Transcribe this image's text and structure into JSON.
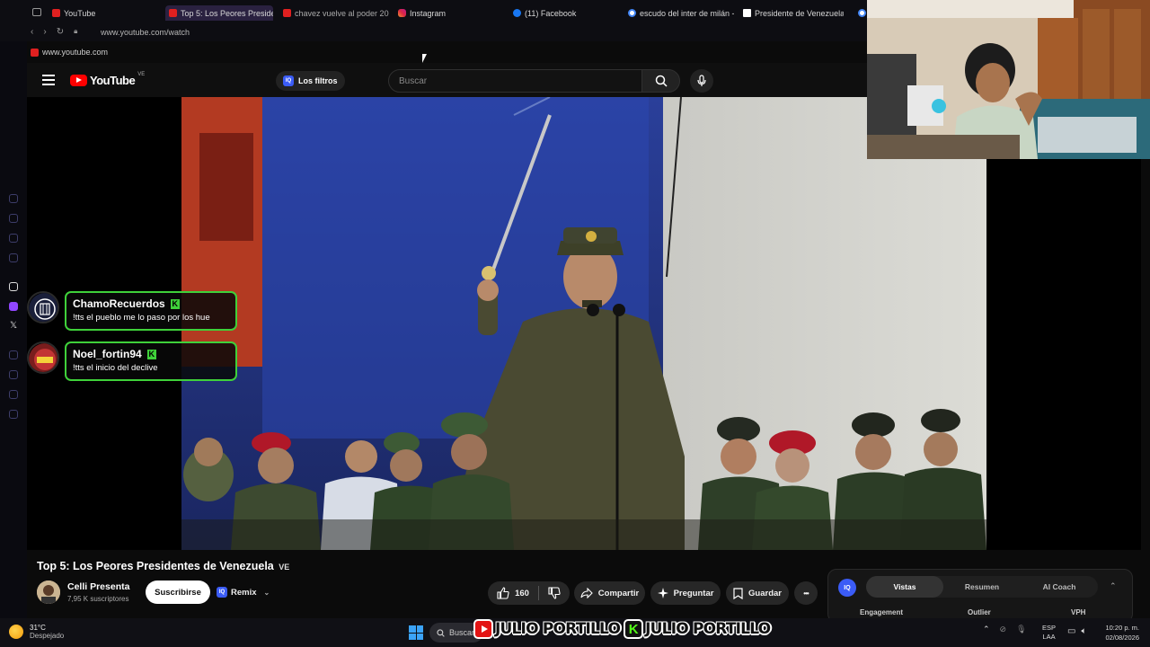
{
  "browser": {
    "tabs": [
      {
        "label": "YouTube",
        "icon": "youtube-favicon",
        "active": false
      },
      {
        "label": "Top 5: Los Peores Presiden",
        "icon": "youtube-favicon",
        "active": true
      },
      {
        "label": "chavez vuelve al poder 20",
        "icon": "youtube-favicon",
        "active": false
      },
      {
        "label": "Instagram",
        "icon": "instagram-favicon",
        "active": false
      },
      {
        "label": "(11) Facebook",
        "icon": "facebook-favicon",
        "active": false
      },
      {
        "label": "escudo del inter de milán -",
        "icon": "google-favicon",
        "active": false
      },
      {
        "label": "Presidente de Venezuela -",
        "icon": "wikipedia-favicon",
        "active": false
      }
    ],
    "url": "www.youtube.com/watch",
    "bookmark": "www.youtube.com"
  },
  "youtube": {
    "logo_text": "YouTube",
    "country_code": "VE",
    "filters_label": "Los filtros",
    "iq_badge": "IQ",
    "search_placeholder": "Buscar"
  },
  "chat": [
    {
      "user": "ChamoRecuerdos",
      "message": "!tts el pueblo me lo paso por los hue",
      "badge": "K"
    },
    {
      "user": "Noel_fortin94",
      "message": "!tts el inicio del declive",
      "badge": "K"
    }
  ],
  "video": {
    "title": "Top 5: Los Peores Presidentes de Venezuela",
    "title_badge": "VE",
    "channel": "Celli Presenta",
    "subscribers": "7,95 K suscriptores",
    "subscribe_label": "Suscribirse",
    "remix_label": "Remix",
    "likes": "160",
    "share_label": "Compartir",
    "ask_label": "Preguntar",
    "save_label": "Guardar",
    "more_label": "•••"
  },
  "analytics": {
    "badge": "IQ",
    "tabs": [
      "Vistas",
      "Resumen",
      "AI Coach"
    ],
    "active_tab": "Vistas",
    "columns": [
      "Engagement",
      "Outlier",
      "VPH"
    ]
  },
  "taskbar": {
    "temperature": "31°C",
    "weather": "Despejado",
    "search_label": "Buscar",
    "brand_text_1": "JULIO PORTILLO",
    "brand_text_2": "JULIO PORTILLO",
    "brand_k": "K",
    "lang_1": "ESP",
    "lang_2": "LAA",
    "time": "10:20 p. m.",
    "date": "02/08/2026"
  },
  "colors": {
    "kick_green": "#3fd13a",
    "youtube_red": "#ff0000",
    "iq_blue": "#3b5cf6"
  }
}
